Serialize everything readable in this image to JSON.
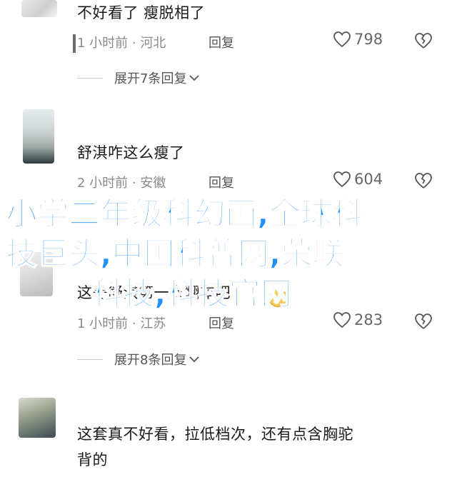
{
  "comments": [
    {
      "text": "不好看了 瘦脱相了",
      "time": "1 小时前",
      "location": "河北",
      "reply_label": "回复",
      "likes": "798",
      "expand_label": "展开7条回复"
    },
    {
      "text": "舒淇咋这么瘦了",
      "time": "2 小时前",
      "location": "安徽",
      "reply_label": "回复",
      "likes": "604",
      "expand_label": ""
    },
    {
      "text": "这是舒淇第一次翻车吧",
      "time": "1 小时前",
      "location": "江苏",
      "reply_label": "回复",
      "likes": "283",
      "expand_label": "展开8条回复"
    },
    {
      "text_line1": "这套真不好看，拉低档次，还有点含胸驼",
      "text_line2": "背的"
    }
  ],
  "overlay": {
    "line1": "小学二年级科幻画,全球科",
    "line2": "技巨头,中国科普网,荣联",
    "line3": "科技,科技官网"
  },
  "separator": "·",
  "colors": {
    "overlay": "#1e90ff",
    "meta": "#8a8a8a"
  }
}
